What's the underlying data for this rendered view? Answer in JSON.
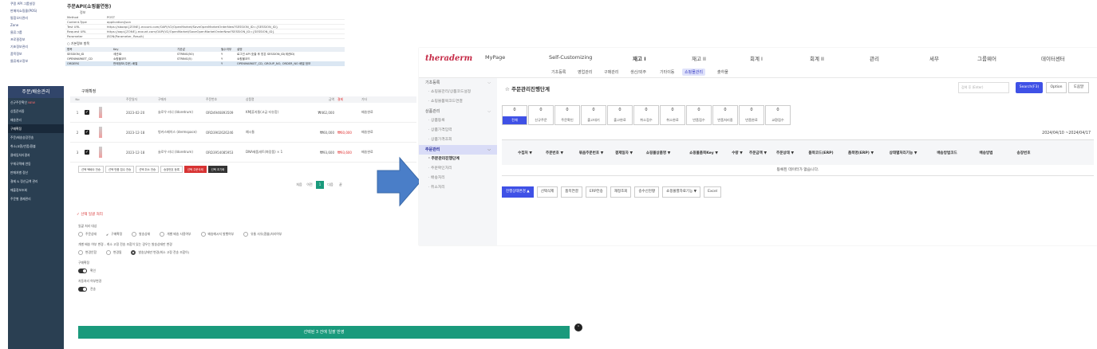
{
  "left": {
    "sidebar_top_items": [
      "쿠팡 API 그룹설정",
      "판매처쇼핑몰(POS)",
      "통합오더관리",
      "Zone",
      "물류그룹",
      "프로필정보",
      "기초정보관리",
      "품목정보",
      "물류재고정보"
    ],
    "sidebar_header": "주문/배송관리",
    "sidebar_items": [
      {
        "label": "신규주문확인",
        "badge": "NEW"
      },
      {
        "label": "상품준비중",
        "badge": ""
      },
      {
        "label": "배송관리",
        "badge": ""
      },
      {
        "label": "구매확정",
        "badge": ""
      },
      {
        "label": "주문/배송송장전송",
        "badge": ""
      },
      {
        "label": "취소/교환/반품/환불",
        "badge": ""
      },
      {
        "label": "클레임처리결과",
        "badge": ""
      },
      {
        "label": "우체국택배 연동",
        "badge": ""
      },
      {
        "label": "판매처별 정산",
        "badge": ""
      },
      {
        "label": "결제 & 정산금액 관리",
        "badge": ""
      },
      {
        "label": "매출정보조회",
        "badge": ""
      },
      {
        "label": "주문별 결제관리",
        "badge": ""
      }
    ],
    "api": {
      "title": "주문API(쇼핑몰연동)",
      "subtitle": "정보",
      "rows": [
        {
          "k": "Method",
          "v": "POST"
        },
        {
          "k": "Content-Type",
          "v": "application/json"
        },
        {
          "k": "Test URL",
          "v": "https://sboapi{ZONE}.ecount.com/OAPI/V2/OpenMarket/SaveOpenMarketOrderNew?SESSION_ID={SESSION_ID}"
        },
        {
          "k": "Request URL",
          "v": "https://oapi{ZONE}.ecount.com/OAPI/V2/OpenMarket/SaveOpenMarketOrderNew?SESSION_ID={SESSION_ID}"
        },
        {
          "k": "Parameter",
          "v": "JSON(Parameter, Result)"
        }
      ],
      "section": "○ 기본정보 항목",
      "param_head": [
        "항목",
        "Key",
        "기본값",
        "필수여부",
        "설명"
      ],
      "params": [
        [
          "SESSION_ID",
          "세션ID",
          "STRING(50)",
          "Y",
          "로그인 API 호출 후 받은 SESSION_ID(세션ID)"
        ],
        [
          "OPENMARKET_CD",
          "쇼핑몰코드",
          "STRING(5)",
          "Y",
          "쇼핑몰코드"
        ],
        [
          "ORDERS",
          "판매정보(주문) 배열",
          "",
          "Y",
          "OPENMARKET_CD, GROUP_NO, ORDER_NO 배열 정보"
        ]
      ]
    },
    "orders": {
      "title": "구매확정",
      "head": [
        "No",
        "",
        "",
        "주문일자",
        "구매자",
        "주문번호",
        "상품명",
        "금액",
        "결제",
        "기타"
      ],
      "rows": [
        {
          "no": "1",
          "date": "2023-02-20",
          "buyer": "슬로우 러너 (Idoretrum)",
          "id": "ORD4946893509",
          "item": "KMJ휴지통(고급 티슈함)",
          "price": "₩462,000",
          "paid": "",
          "etc": "배송완료"
        },
        {
          "no": "2",
          "date": "2023-12-18",
          "buyer": "벙커스페이스 (dermspace)",
          "id": "ORD3902626246",
          "item": "예시통",
          "price": "₩60,000",
          "paid": "₩60,000",
          "etc": "배송완료"
        },
        {
          "no": "3",
          "date": "2023-12-18",
          "buyer": "슬로우 러너 (Idoretrum)",
          "id": "ORD3954085953",
          "item": "DNA제품세트(화장품) × 1",
          "price": "₩93,600",
          "paid": "₩93,600",
          "etc": "배송완료"
        }
      ],
      "actions": [
        "선택 택배사 전송",
        "선택 반품 접수 전송",
        "선택 취소 전송",
        "송장번호 등록",
        "선택 주문삭제",
        "선택 초기화"
      ],
      "pager": [
        "처음",
        "이전",
        "1",
        "다음",
        "끝"
      ]
    },
    "bulk": {
      "title": "✓ 선택 일괄 처리",
      "label1": "일괄 처리 대상",
      "opts1": [
        "주문상태",
        "구매확정",
        "발송상태",
        "개별 배송 사용여부",
        "배송메시지 발행여부",
        "유통 사유(환불)처리여부"
      ],
      "label2": "개별 배송 여부 변경 – 최소 고정 전송 조합이 있는 경우는 발송상태만 변경",
      "opts2": [
        "변경안함",
        "변경됨",
        "발송상태만 변경(최소 고정 전송 조합이)"
      ],
      "toggle1_label": "구매확정",
      "toggle1_text": "확인",
      "toggle2_label": "자동처리 여부변경",
      "toggle2_text": "전송",
      "apply": "선택된 3 건에 일괄 반영"
    }
  },
  "right": {
    "logo": "theraderm",
    "menu": [
      "MyPage",
      "Self-Customizing",
      "재고 I",
      "재고 II",
      "회계 I",
      "회계 II",
      "관리",
      "세무",
      "그룹웨어",
      "데이터센터"
    ],
    "submenu": [
      "기초등록",
      "영업관리",
      "구매관리",
      "생산/외주",
      "기타이동",
      "쇼핑몰관리",
      "출하물"
    ],
    "submenu_active": 5,
    "side": [
      {
        "type": "sec",
        "label": "기초등록"
      },
      {
        "type": "item",
        "label": "쇼핑몰관리/상품코드설정"
      },
      {
        "type": "item",
        "label": "쇼핑몰품목코드연결"
      },
      {
        "type": "sec",
        "label": "상품관리"
      },
      {
        "type": "item",
        "label": "상품등록"
      },
      {
        "type": "item",
        "label": "상품가격입력"
      },
      {
        "type": "item",
        "label": "상품가격조회"
      },
      {
        "type": "sec_on",
        "label": "주문관리"
      },
      {
        "type": "item_on",
        "label": "주문관리진행단계"
      },
      {
        "type": "item",
        "label": "주문확인처리"
      },
      {
        "type": "item",
        "label": "배송처리"
      },
      {
        "type": "item",
        "label": "취소처리"
      }
    ],
    "title": "주문관리진행단계",
    "search_placeholder": "검색 후 (Enter)",
    "search_btn": "Search(F3)",
    "option_btn": "Option",
    "help_btn": "도움말",
    "status": [
      {
        "num": "0",
        "label": "전체"
      },
      {
        "num": "0",
        "label": "신규주문"
      },
      {
        "num": "0",
        "label": "주문확인"
      },
      {
        "num": "0",
        "label": "출고대기"
      },
      {
        "num": "0",
        "label": "출고완료"
      },
      {
        "num": "0",
        "label": "취소접수"
      },
      {
        "num": "0",
        "label": "취소완료"
      },
      {
        "num": "0",
        "label": "반품접수"
      },
      {
        "num": "0",
        "label": "반품처리중"
      },
      {
        "num": "0",
        "label": "반품완료"
      },
      {
        "num": "0",
        "label": "교환접수"
      }
    ],
    "date_range": "2024/04/10 ~2024/04/17",
    "table_head": [
      "",
      "수집처 ▼",
      "주문번호 ▼",
      "묶음주문번호 ▼",
      "결제일자 ▼",
      "쇼핑몰상품명 ▼",
      "쇼핑몰품목Key ▼",
      "수량 ▼",
      "주문금액 ▼",
      "주문상태 ▼",
      "품목코드(ERP)",
      "품목명(ERP) ▼",
      "상태별처리기능 ▼",
      "배송방법코드",
      "배송방법",
      "송장번호"
    ],
    "empty_text": "등록된 데이터가 없습니다.",
    "actions": [
      "진행상태변경 ▲",
      "선택삭제",
      "품목연결",
      "ERP전송",
      "재정조회",
      "송수신현황",
      "쇼핑몰별자료기능 ▼",
      "Excel"
    ]
  }
}
